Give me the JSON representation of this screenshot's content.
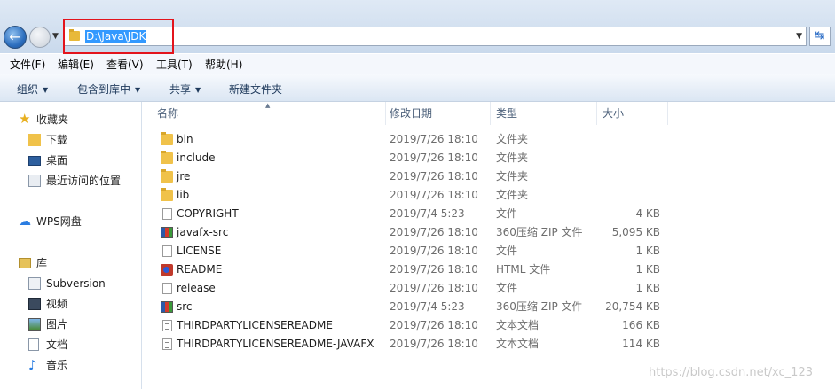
{
  "address_bar": {
    "path": "D:\\Java\\JDK"
  },
  "menu": [
    "文件(F)",
    "编辑(E)",
    "查看(V)",
    "工具(T)",
    "帮助(H)"
  ],
  "toolbar": {
    "organize": "组织",
    "include_in_library": "包含到库中",
    "share": "共享",
    "new_folder": "新建文件夹"
  },
  "nav_pane": {
    "favorites": "收藏夹",
    "downloads": "下载",
    "desktop": "桌面",
    "recent": "最近访问的位置",
    "wps_drive": "WPS网盘",
    "libraries": "库",
    "subversion": "Subversion",
    "videos": "视频",
    "pictures": "图片",
    "documents": "文档",
    "music": "音乐"
  },
  "columns": {
    "name": "名称",
    "date_modified": "修改日期",
    "type": "类型",
    "size": "大小"
  },
  "files": [
    {
      "name": "bin",
      "date": "2019/7/26 18:10",
      "type": "文件夹",
      "size": "",
      "icon": "folder"
    },
    {
      "name": "include",
      "date": "2019/7/26 18:10",
      "type": "文件夹",
      "size": "",
      "icon": "folder"
    },
    {
      "name": "jre",
      "date": "2019/7/26 18:10",
      "type": "文件夹",
      "size": "",
      "icon": "folder"
    },
    {
      "name": "lib",
      "date": "2019/7/26 18:10",
      "type": "文件夹",
      "size": "",
      "icon": "folder"
    },
    {
      "name": "COPYRIGHT",
      "date": "2019/7/4 5:23",
      "type": "文件",
      "size": "4 KB",
      "icon": "file"
    },
    {
      "name": "javafx-src",
      "date": "2019/7/26 18:10",
      "type": "360压缩 ZIP 文件",
      "size": "5,095 KB",
      "icon": "zip"
    },
    {
      "name": "LICENSE",
      "date": "2019/7/26 18:10",
      "type": "文件",
      "size": "1 KB",
      "icon": "file"
    },
    {
      "name": "README",
      "date": "2019/7/26 18:10",
      "type": "HTML 文件",
      "size": "1 KB",
      "icon": "html"
    },
    {
      "name": "release",
      "date": "2019/7/26 18:10",
      "type": "文件",
      "size": "1 KB",
      "icon": "file"
    },
    {
      "name": "src",
      "date": "2019/7/4 5:23",
      "type": "360压缩 ZIP 文件",
      "size": "20,754 KB",
      "icon": "zip"
    },
    {
      "name": "THIRDPARTYLICENSEREADME",
      "date": "2019/7/26 18:10",
      "type": "文本文档",
      "size": "166 KB",
      "icon": "txt"
    },
    {
      "name": "THIRDPARTYLICENSEREADME-JAVAFX",
      "date": "2019/7/26 18:10",
      "type": "文本文档",
      "size": "114 KB",
      "icon": "txt"
    }
  ],
  "watermark": "https://blog.csdn.net/xc_123"
}
